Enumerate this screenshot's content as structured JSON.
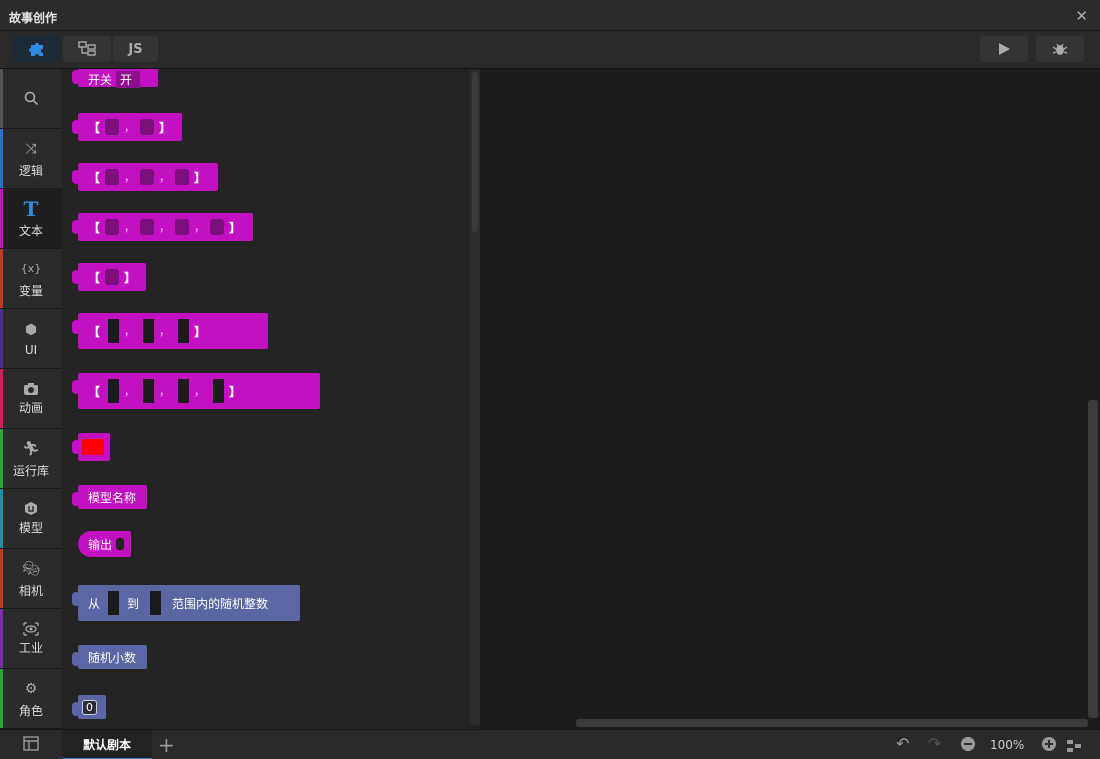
{
  "window": {
    "title": "故事创作",
    "close_icon": "close-icon"
  },
  "toolbar": {
    "tabs": [
      {
        "icon": "puzzle-icon",
        "label": ""
      },
      {
        "icon": "hierarchy-icon",
        "label": ""
      },
      {
        "icon": "js-icon",
        "label": "JS"
      }
    ],
    "run_icon": "play-icon",
    "debug_icon": "bug-icon"
  },
  "categories": [
    {
      "label": "",
      "icon": "search-icon",
      "color": "#555555"
    },
    {
      "label": "逻辑",
      "icon": "shuffle-icon",
      "color": "#2f6fd0"
    },
    {
      "label": "文本",
      "icon": "text-icon",
      "color": "#c210c2"
    },
    {
      "label": "变量",
      "icon": "variable-icon",
      "color": "#c0392b"
    },
    {
      "label": "UI",
      "icon": "cube-icon",
      "color": "#4b2e8f"
    },
    {
      "label": "动画",
      "icon": "camera-icon",
      "color": "#d01f5e"
    },
    {
      "label": "运行库",
      "icon": "run-icon",
      "color": "#2e9e3e"
    },
    {
      "label": "模型",
      "icon": "model-icon",
      "color": "#1f8fa0"
    },
    {
      "label": "相机",
      "icon": "mask-icon",
      "color": "#c0392b"
    },
    {
      "label": "工业",
      "icon": "eye-icon",
      "color": "#7b2fa8"
    },
    {
      "label": "角色",
      "icon": "gear-icon",
      "color": "#2e9e3e"
    }
  ],
  "flyout": {
    "switch_block": {
      "label": "开关",
      "value": "开"
    },
    "list_sep": "，",
    "color_block": {
      "value": "#ff0000"
    },
    "model_name_block": "模型名称",
    "output_block": "输出",
    "random_int": {
      "from": "从",
      "to": "到",
      "suffix": "范围内的随机整数"
    },
    "random_float": "随机小数",
    "number_block": "0"
  },
  "bottom": {
    "script_tab": "默认剧本",
    "add_icon": "plus-icon",
    "zoom": "100%"
  }
}
